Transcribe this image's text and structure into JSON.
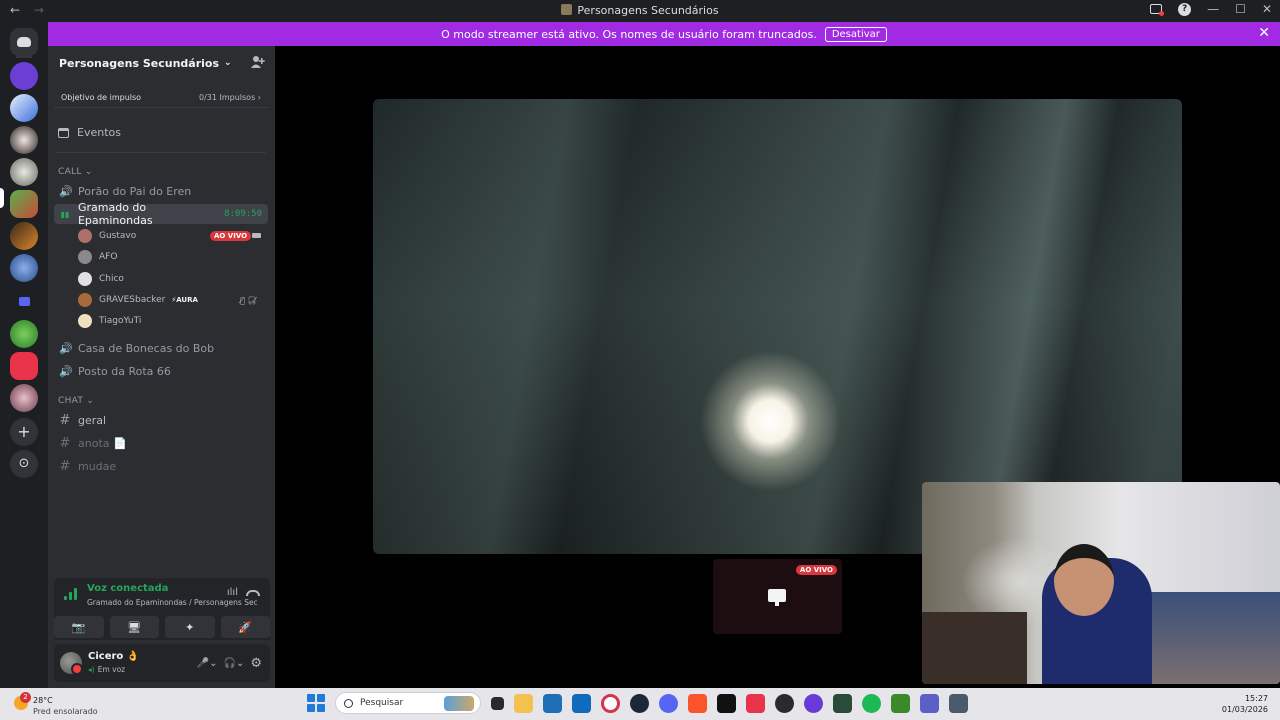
{
  "window": {
    "title": "Personagens Secundários",
    "nav_back": "←",
    "nav_forward": "→",
    "help": "?",
    "minimize": "—",
    "maximize": "☐",
    "close": "✕"
  },
  "banner": {
    "text": "O modo streamer está ativo. Os nomes de usuário foram truncados.",
    "button": "Desativar",
    "close": "✕"
  },
  "rail": {
    "add_server": "+",
    "explore": "⊙"
  },
  "server": {
    "name": "Personagens Secundários",
    "chevron": "⌄",
    "boost_label": "Objetivo de impulso",
    "boost_progress": "0/31 Impulsos ›",
    "events": "Eventos"
  },
  "categories": {
    "call": "CALL ⌄",
    "chat": "CHAT ⌄"
  },
  "voice_channels": [
    {
      "name": "Porão do Pai do Eren",
      "icon": "🔊"
    },
    {
      "name": "Gramado do Epaminondas",
      "icon": "▮▮",
      "timer": "8:09:50",
      "active": true
    },
    {
      "name": "Casa de Bonecas do Bob",
      "icon": "🔊"
    },
    {
      "name": "Posto da Rota 66",
      "icon": "🔊"
    }
  ],
  "voice_users": [
    {
      "name": "Gustavo",
      "live": "AO VIVO",
      "avatar_color": "#b0706a"
    },
    {
      "name": "AFO",
      "avatar_color": "#8a8a8a"
    },
    {
      "name": "Chico",
      "avatar_color": "#e0e0e0"
    },
    {
      "name": "GRAVESbacker",
      "badge": "⚡AURA",
      "muted": "🎙̸ 🎧̸",
      "avatar_color": "#a86a3a"
    },
    {
      "name": "TiagoYuTi",
      "avatar_color": "#f0e0c0"
    }
  ],
  "text_channels": [
    {
      "name": "geral",
      "icon": "#"
    },
    {
      "name": "anota 📄",
      "icon": "#"
    },
    {
      "name": "mudae",
      "icon": "#"
    }
  ],
  "voice_panel": {
    "status": "Voz conectada",
    "location": "Gramado do Epaminondas / Personagens Secu...",
    "wave": "ılıl",
    "buttons": [
      "📷",
      "🖥",
      "✦",
      "🚀"
    ]
  },
  "user": {
    "name": "Cicero 👌",
    "status": "Em voz",
    "mic": "🎤⌄",
    "headset": "🎧⌄",
    "settings": "⚙"
  },
  "stage": {
    "live_badge": "AO VIVO"
  },
  "taskbar": {
    "weather_badge": "2",
    "temp": "28°C",
    "forecast": "Pred ensolarado",
    "search_placeholder": "Pesquisar",
    "time": "15:27",
    "date": "01/03/2026"
  },
  "colors": {
    "accent_purple": "#a12be3",
    "voice_green": "#23a55a",
    "live_red": "#da373c",
    "sidebar": "#2b2d31",
    "rail": "#1e1f22"
  }
}
